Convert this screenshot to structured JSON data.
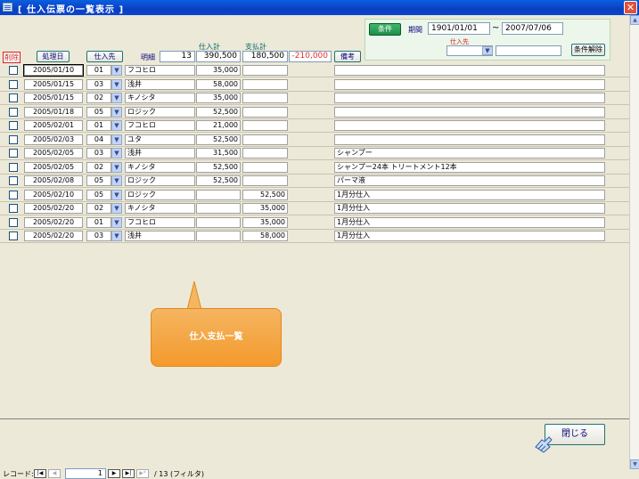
{
  "window": {
    "title": "[ 仕入伝票の一覧表示 ]",
    "close_glyph": "✕"
  },
  "filter": {
    "condition_button": "条件",
    "period_label": "期間",
    "date_from": "1901/01/01",
    "tilde": "~",
    "date_to": "2007/07/06",
    "supplier_label": "仕入先",
    "supplier_value": "",
    "supplier_name": "",
    "clear_button": "条件解除"
  },
  "header": {
    "delete_label": "削除",
    "date_button": "処理日",
    "supplier_button": "仕入先",
    "count_label": "明細",
    "count_value": "13",
    "purchase_total_label": "仕入計",
    "purchase_total": "390,500",
    "payment_total_label": "支払計",
    "payment_total": "180,500",
    "balance": "-210,000",
    "memo_button": "備考"
  },
  "rows": [
    {
      "date": "2005/01/10",
      "code": "01",
      "name": "フコヒロ",
      "purchase": "35,000",
      "payment": "",
      "memo": ""
    },
    {
      "date": "2005/01/15",
      "code": "03",
      "name": "浅井",
      "purchase": "58,000",
      "payment": "",
      "memo": ""
    },
    {
      "date": "2005/01/15",
      "code": "02",
      "name": "キノシタ",
      "purchase": "35,000",
      "payment": "",
      "memo": ""
    },
    {
      "date": "2005/01/18",
      "code": "05",
      "name": "ロジック",
      "purchase": "52,500",
      "payment": "",
      "memo": ""
    },
    {
      "date": "2005/02/01",
      "code": "01",
      "name": "フコヒロ",
      "purchase": "21,000",
      "payment": "",
      "memo": ""
    },
    {
      "date": "2005/02/03",
      "code": "04",
      "name": "ユタ",
      "purchase": "52,500",
      "payment": "",
      "memo": ""
    },
    {
      "date": "2005/02/05",
      "code": "03",
      "name": "浅井",
      "purchase": "31,500",
      "payment": "",
      "memo": "シャンプー"
    },
    {
      "date": "2005/02/05",
      "code": "02",
      "name": "キノシタ",
      "purchase": "52,500",
      "payment": "",
      "memo": "シャンプー24本 トリートメント12本"
    },
    {
      "date": "2005/02/08",
      "code": "05",
      "name": "ロジック",
      "purchase": "52,500",
      "payment": "",
      "memo": "パーマ液"
    },
    {
      "date": "2005/02/10",
      "code": "05",
      "name": "ロジック",
      "purchase": "",
      "payment": "52,500",
      "memo": "1月分仕入"
    },
    {
      "date": "2005/02/20",
      "code": "02",
      "name": "キノシタ",
      "purchase": "",
      "payment": "35,000",
      "memo": "1月分仕入"
    },
    {
      "date": "2005/02/20",
      "code": "01",
      "name": "フコヒロ",
      "purchase": "",
      "payment": "35,000",
      "memo": "1月分仕入"
    },
    {
      "date": "2005/02/20",
      "code": "03",
      "name": "浅井",
      "purchase": "",
      "payment": "58,000",
      "memo": "1月分仕入"
    }
  ],
  "callout": {
    "text": "仕入支払一覧"
  },
  "close_button": "閉じる",
  "navigation": {
    "record_label": "レコード:",
    "current": "1",
    "total_text": "/ 13 (フィルタ)"
  },
  "colors": {
    "balance_negative": "#e03030",
    "supplier_label": "#d02020",
    "delete_label": "#d02020"
  }
}
